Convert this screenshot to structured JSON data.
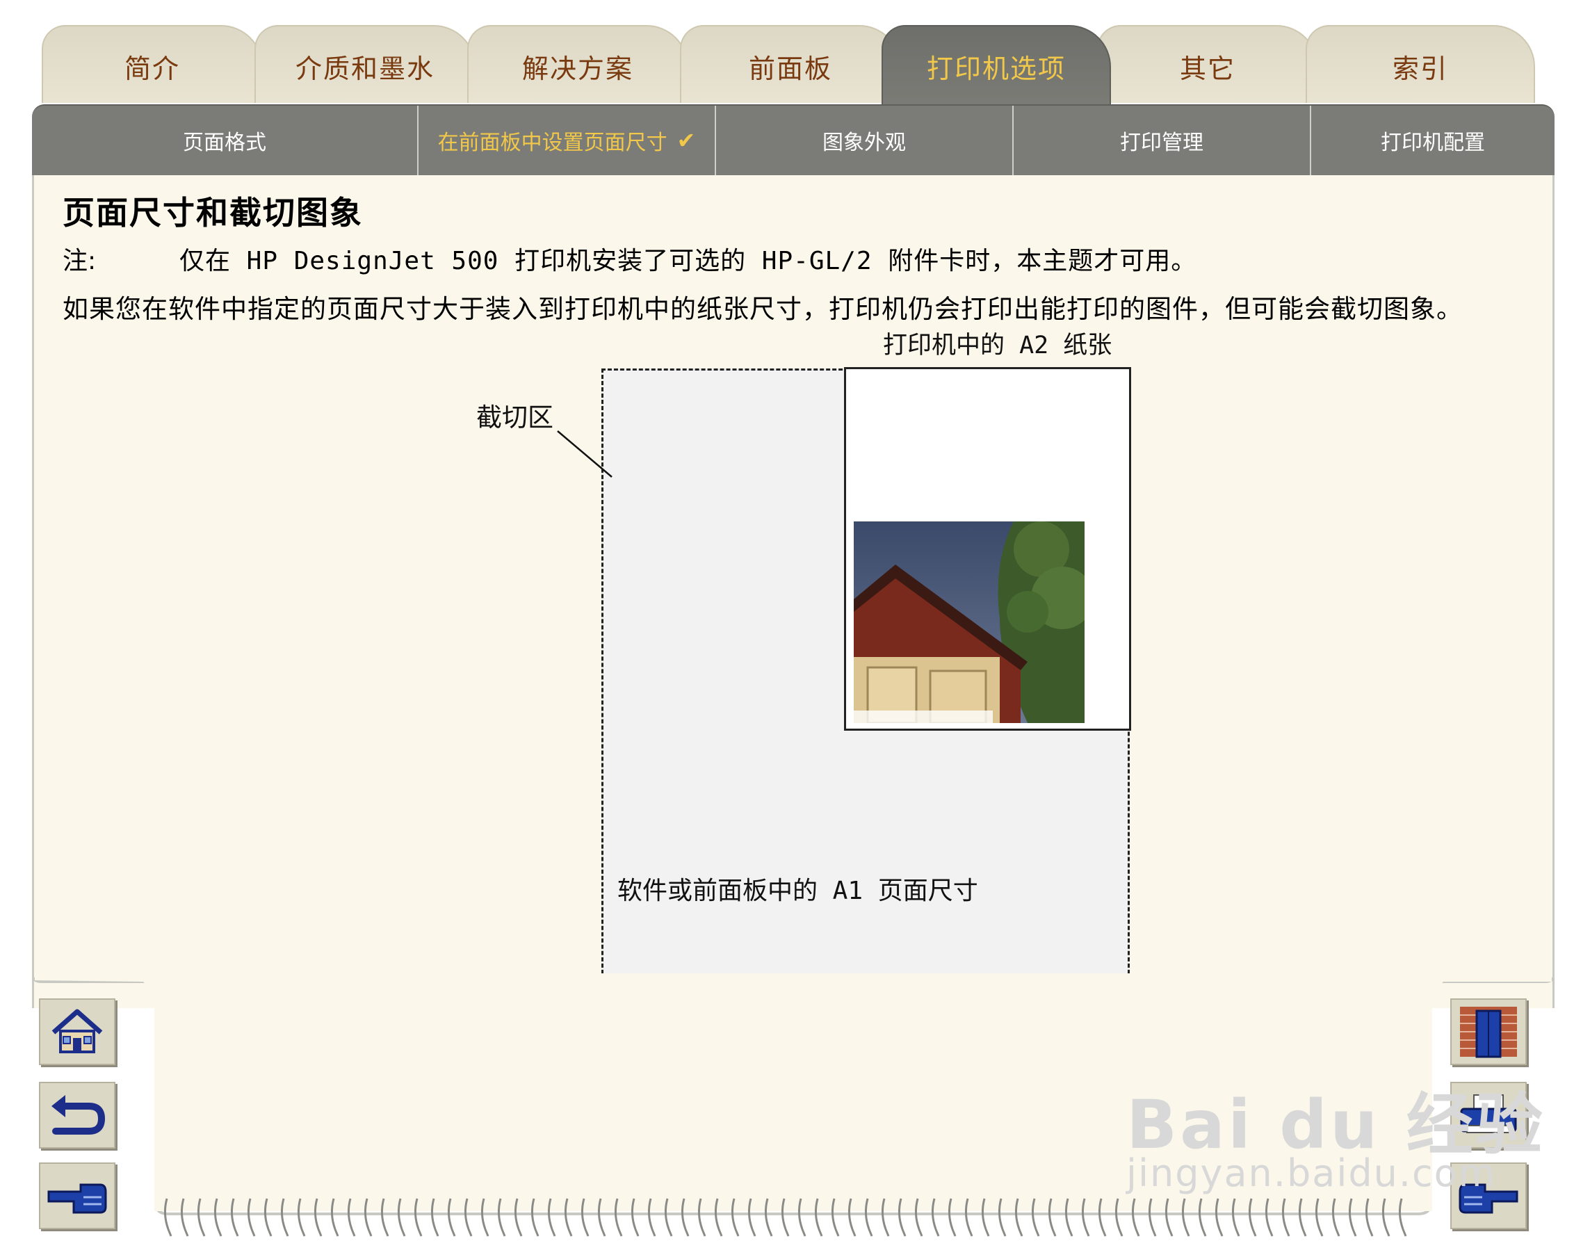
{
  "tabs": [
    {
      "label": "简介",
      "active": false
    },
    {
      "label": "介质和墨水",
      "active": false
    },
    {
      "label": "解决方案",
      "active": false
    },
    {
      "label": "前面板",
      "active": false
    },
    {
      "label": "打印机选项",
      "active": true
    },
    {
      "label": "其它",
      "active": false
    },
    {
      "label": "索引",
      "active": false
    }
  ],
  "subtabs": [
    {
      "label": "页面格式",
      "active": false
    },
    {
      "label": "在前面板中设置页面尺寸",
      "active": true,
      "check": "✔"
    },
    {
      "label": "图象外观",
      "active": false
    },
    {
      "label": "打印管理",
      "active": false
    },
    {
      "label": "打印机配置",
      "active": false
    }
  ],
  "content": {
    "title": "页面尺寸和截切图象",
    "note_label": "注:",
    "note_text": "仅在 HP DesignJet 500 打印机安装了可选的 HP-GL/2 附件卡时，本主题才可用。",
    "body": "如果您在软件中指定的页面尺寸大于装入到打印机中的纸张尺寸，打印机仍会打印出能打印的图件，但可能会截切图象。"
  },
  "diagram": {
    "a2_label": "打印机中的 A2 纸张",
    "crop_label": "截切区",
    "a1_label": "软件或前面板中的 A1 页面尺寸"
  },
  "nav": {
    "home_icon": "home-icon",
    "back_icon": "back-icon",
    "prev_icon": "hand-pointing-left-icon",
    "exit_icon": "door-icon",
    "print_icon": "printer-icon",
    "next_icon": "hand-pointing-right-icon"
  },
  "watermark": {
    "brand": "Bai du 经验",
    "url": "jingyan.baidu.com"
  },
  "colors": {
    "tab_text": "#7a3a10",
    "active_text": "#f2c84a",
    "bar": "#7b7b77",
    "panel": "#fbf7ea"
  }
}
